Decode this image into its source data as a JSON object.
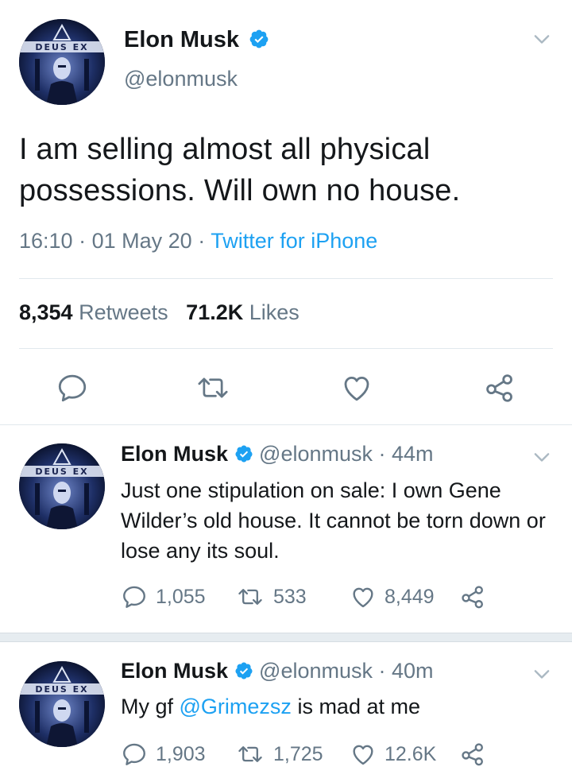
{
  "main_tweet": {
    "user": {
      "name": "Elon Musk",
      "handle": "@elonmusk",
      "avatar_text": "DEUS EX"
    },
    "text": "I am selling almost all physical possessions. Will own no house.",
    "time": "16:10",
    "date": "01 May 20",
    "source": "Twitter for iPhone",
    "retweets_count": "8,354",
    "retweets_label": "Retweets",
    "likes_count": "71.2K",
    "likes_label": "Likes"
  },
  "replies": [
    {
      "name": "Elon Musk",
      "handle": "@elonmusk",
      "time_ago": "44m",
      "text": "Just one stipulation on sale: I own Gene Wilder’s old house. It cannot be torn down or lose any its soul.",
      "reply_count": "1,055",
      "retweet_count": "533",
      "like_count": "8,449"
    },
    {
      "name": "Elon Musk",
      "handle": "@elonmusk",
      "time_ago": "40m",
      "text_before": "My gf ",
      "mention": "@Grimezsz",
      "text_after": " is mad at me",
      "reply_count": "1,903",
      "retweet_count": "1,725",
      "like_count": "12.6K"
    }
  ],
  "colors": {
    "accent": "#1da1f2",
    "muted": "#657786",
    "text": "#14171a",
    "divider": "#e1e8ed"
  },
  "icons": [
    "verified-badge-icon",
    "chevron-down-icon",
    "reply-icon",
    "retweet-icon",
    "like-icon",
    "share-icon"
  ]
}
